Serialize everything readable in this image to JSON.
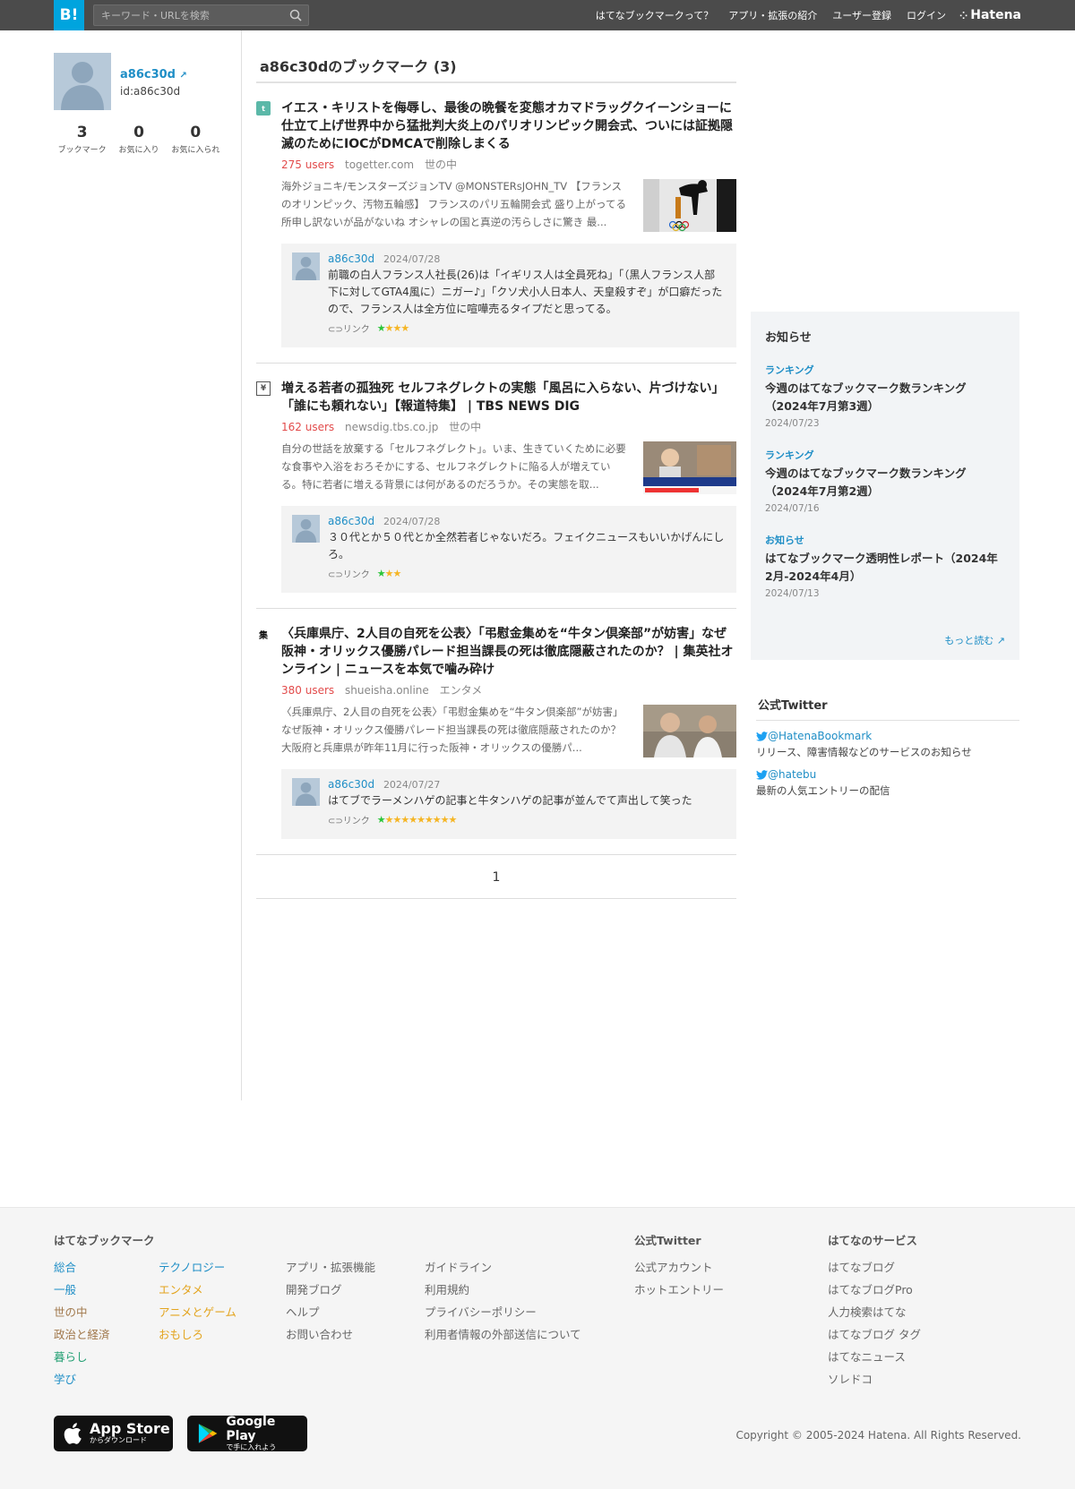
{
  "header": {
    "logo": "B!",
    "search_placeholder": "キーワード・URLを検索",
    "nav": [
      "はてなブックマークって？",
      "アプリ・拡張の紹介",
      "ユーザー登録",
      "ログイン"
    ],
    "brand": "Hatena"
  },
  "profile": {
    "name": "a86c30d",
    "id": "id:a86c30d",
    "stats": [
      {
        "num": "3",
        "label": "ブックマーク"
      },
      {
        "num": "0",
        "label": "お気に入り"
      },
      {
        "num": "0",
        "label": "お気に入られ"
      }
    ]
  },
  "main": {
    "heading": "a86c30dのブックマーク (3)",
    "entries": [
      {
        "favicon": "togetter-icon",
        "title": "イエス・キリストを侮辱し、最後の晩餐を変態オカマドラッグクイーンショーに仕立て上げ世界中から猛批判大炎上のパリオリンピック開会式、ついには証拠隠滅のためにIOCがDMCAで削除しまくる",
        "users": "275 users",
        "domain": "togetter.com",
        "category": "世の中",
        "summary": "海外ジョニキ/モンスターズジョンTV @MONSTERsJOHN_TV 【フランスのオリンピック、汚物五輪感】 フランスのパリ五輪開会式 盛り上がってる所申し訳ないが品がないね オシャレの国と真逆の汚らしさに驚き 最...",
        "comment": {
          "user": "a86c30d",
          "date": "2024/07/28",
          "text": "前職の白人フランス人社長(26)は「イギリス人は全員死ね」「（黒人フランス人部下に対してGTA4風に）ニガー♪」「クソ犬小人日本人、天皇殺すぞ」が口癖だったので、フランス人は全方位に喧嘩売るタイプだと思ってる。",
          "link": "リンク",
          "green_stars": "★",
          "yellow_stars": "★★★"
        }
      },
      {
        "favicon": "document-yen-icon",
        "title": "増える若者の孤独死 セルフネグレクトの実態「風呂に入らない、片づけない」「誰にも頼れない」【報道特集】 | TBS NEWS DIG",
        "users": "162 users",
        "domain": "newsdig.tbs.co.jp",
        "category": "世の中",
        "summary": "自分の世話を放棄する「セルフネグレクト」。いま、生きていくために必要な食事や入浴をおろそかにする、セルフネグレクトに陥る人が増えている。特に若者に増える背景には何があるのだろうか。その実態を取...",
        "comment": {
          "user": "a86c30d",
          "date": "2024/07/28",
          "text": "３０代とか５０代とか全然若者じゃないだろ。フェイクニュースもいいかげんにしろ。",
          "link": "リンク",
          "green_stars": "★",
          "yellow_stars": "★★"
        }
      },
      {
        "favicon": "shueisha-icon",
        "title": "〈兵庫県庁、2人目の自死を公表〉「弔慰金集めを“牛タン倶楽部”が妨害」なぜ阪神・オリックス優勝パレード担当課長の死は徹底隠蔽されたのか？ | 集英社オンライン | ニュースを本気で噛み砕け",
        "users": "380 users",
        "domain": "shueisha.online",
        "category": "エンタメ",
        "summary": "〈兵庫県庁、2人目の自死を公表〉「弔慰金集めを“牛タン倶楽部”が妨害」なぜ阪神・オリックス優勝パレード担当課長の死は徹底隠蔽されたのか？ 大阪府と兵庫県が昨年11月に行った阪神・オリックスの優勝パ...",
        "comment": {
          "user": "a86c30d",
          "date": "2024/07/27",
          "text": "はてブでラーメンハゲの記事と牛タンハゲの記事が並んでて声出して笑った",
          "link": "リンク",
          "green_stars": "★",
          "yellow_stars": "★★★★★★★★★"
        }
      }
    ],
    "page": "1"
  },
  "notices": {
    "title": "お知らせ",
    "items": [
      {
        "cat": "ランキング",
        "title": "今週のはてなブックマーク数ランキング（2024年7月第3週）",
        "date": "2024/07/23"
      },
      {
        "cat": "ランキング",
        "title": "今週のはてなブックマーク数ランキング（2024年7月第2週）",
        "date": "2024/07/16"
      },
      {
        "cat": "お知らせ",
        "title": "はてなブックマーク透明性レポート（2024年2月-2024年4月）",
        "date": "2024/07/13"
      }
    ],
    "more": "もっと読む"
  },
  "twitter": {
    "title": "公式Twitter",
    "items": [
      {
        "handle": "@HatenaBookmark",
        "desc": "リリース、障害情報などのサービスのお知らせ"
      },
      {
        "handle": "@hatebu",
        "desc": "最新の人気エントリーの配信"
      }
    ]
  },
  "footer": {
    "col1_head": "はてなブックマーク",
    "cats_a": [
      "総合",
      "一般",
      "世の中",
      "政治と経済",
      "暮らし",
      "学び"
    ],
    "cats_b": [
      "テクノロジー",
      "エンタメ",
      "アニメとゲーム",
      "おもしろ"
    ],
    "links_c": [
      "アプリ・拡張機能",
      "開発ブログ",
      "ヘルプ",
      "お問い合わせ"
    ],
    "links_d": [
      "ガイドライン",
      "利用規約",
      "プライバシーポリシー",
      "利用者情報の外部送信について"
    ],
    "tw_head": "公式Twitter",
    "tw_links": [
      "公式アカウント",
      "ホットエントリー"
    ],
    "svc_head": "はてなのサービス",
    "svc_links": [
      "はてなブログ",
      "はてなブログPro",
      "人力検索はてな",
      "はてなブログ タグ",
      "はてなニュース",
      "ソレドコ"
    ],
    "appstore_main": "App Store",
    "appstore_sub": "からダウンロード",
    "googleplay_main": "Google Play",
    "googleplay_sub": "で手に入れよう",
    "copyright": "Copyright © 2005-2024 Hatena. All Rights Reserved."
  }
}
